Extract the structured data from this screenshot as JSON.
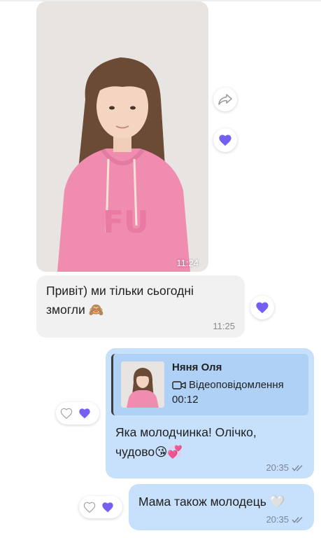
{
  "messages": {
    "incoming_photo": {
      "time": "11:24"
    },
    "incoming_text": {
      "text": "Привіт) ми тільки сьогодні змогли 🙈",
      "time": "11:25"
    },
    "outgoing_reply": {
      "quote": {
        "author": "Няня Оля",
        "type_label": "Відеоповідомлення",
        "duration": "00:12"
      },
      "text": "Яка молодчинка! Олічко, чудово😘💞",
      "time": "20:35"
    },
    "outgoing_text": {
      "text": "Мама також молодець 🤍",
      "time": "20:35"
    }
  },
  "icons": {
    "share": "share-arrow-icon",
    "reaction_filled": "heart-icon",
    "reaction_outline": "heart-outline-icon",
    "read_receipt": "double-check-icon",
    "video": "video-camera-icon"
  },
  "colors": {
    "accent": "#7360f2",
    "outgoing_bubble": "#c7e0fb",
    "incoming_bubble": "#f1f1f1"
  }
}
